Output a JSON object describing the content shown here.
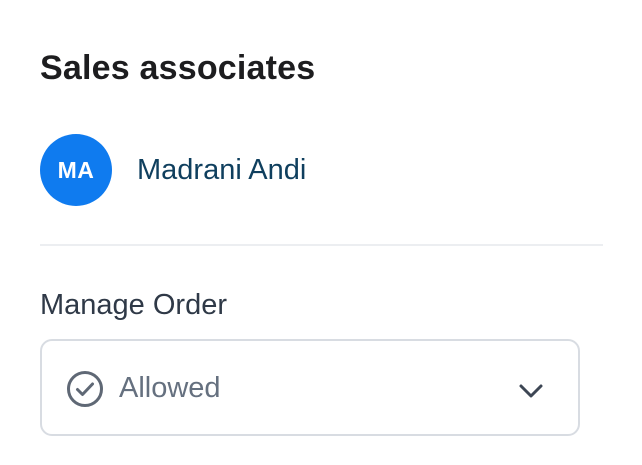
{
  "section": {
    "title": "Sales associates"
  },
  "associate": {
    "initials": "MA",
    "name": "Madrani Andi",
    "avatar_color": "#0f7bef"
  },
  "permission": {
    "label": "Manage Order",
    "selected_value": "Allowed",
    "value_icon": "check-circle-icon",
    "dropdown_icon": "chevron-down-icon"
  }
}
